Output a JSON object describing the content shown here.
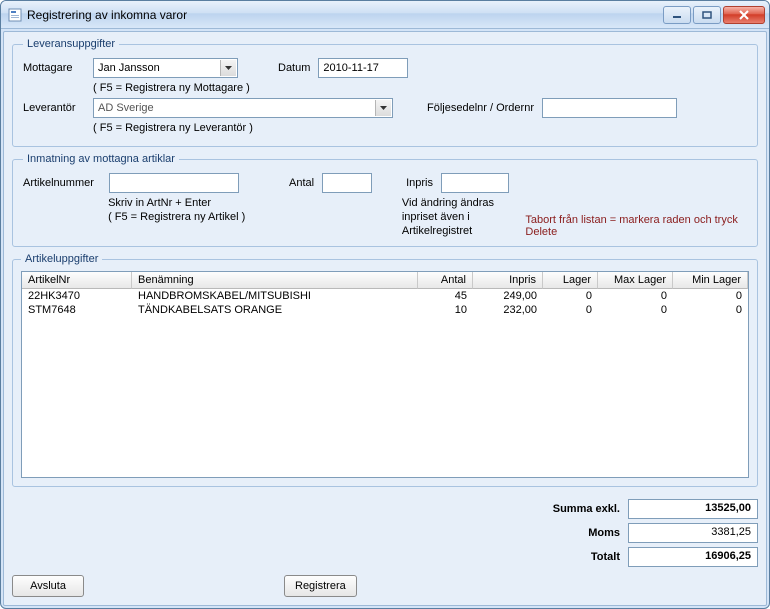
{
  "window": {
    "title": "Registrering av inkomna varor"
  },
  "section1": {
    "legend": "Leveransuppgifter",
    "mottagare_label": "Mottagare",
    "mottagare_value": "Jan Jansson",
    "mottagare_hint": "( F5 = Registrera ny Mottagare )",
    "datum_label": "Datum",
    "datum_value": "2010-11-17",
    "lev_label": "Leverantör",
    "lev_value": "AD Sverige",
    "lev_hint": "( F5 = Registrera ny Leverantör )",
    "foljesedel_label": "Följesedelnr / Ordernr",
    "foljesedel_value": ""
  },
  "section2": {
    "legend": "Inmatning av mottagna artiklar",
    "artnr_label": "Artikelnummer",
    "artnr_value": "",
    "artnr_hint1": "Skriv in ArtNr + Enter",
    "artnr_hint2": "( F5 = Registrera ny Artikel )",
    "antal_label": "Antal",
    "antal_value": "",
    "inpris_label": "Inpris",
    "inpris_value": "",
    "inpris_note": "Vid ändring ändras inpriset även i Artikelregistret",
    "delete_hint": "Tabort från listan =  markera raden och tryck Delete"
  },
  "grid": {
    "legend": "Artikeluppgifter",
    "headers": {
      "art": "ArtikelNr",
      "ben": "Benämning",
      "antal": "Antal",
      "inpris": "Inpris",
      "lager": "Lager",
      "max": "Max Lager",
      "min": "Min Lager"
    },
    "rows": [
      {
        "art": "22HK3470",
        "ben": "HANDBROMSKABEL/MITSUBISHI",
        "antal": "45",
        "inpris": "249,00",
        "lager": "0",
        "max": "0",
        "min": "0"
      },
      {
        "art": "STM7648",
        "ben": "TÄNDKABELSATS ORANGE",
        "antal": "10",
        "inpris": "232,00",
        "lager": "0",
        "max": "0",
        "min": "0"
      }
    ]
  },
  "totals": {
    "sum_label": "Summa exkl.",
    "sum_value": "13525,00",
    "moms_label": "Moms",
    "moms_value": "3381,25",
    "total_label": "Totalt",
    "total_value": "16906,25"
  },
  "buttons": {
    "close": "Avsluta",
    "register": "Registrera"
  }
}
